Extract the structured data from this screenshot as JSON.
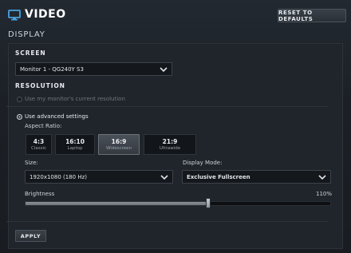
{
  "header": {
    "title": "VIDEO",
    "reset_label": "RESET TO DEFAULTS"
  },
  "subheader": "DISPLAY",
  "screen": {
    "section_label": "SCREEN",
    "monitor_value": "Monitor 1 - QG240Y S3"
  },
  "resolution": {
    "section_label": "RESOLUTION",
    "option_current": "Use my monitor's current resolution",
    "option_advanced": "Use advanced settings",
    "selected": "advanced",
    "aspect_label": "Aspect Ratio:",
    "aspect_options": [
      {
        "ratio": "4:3",
        "name": "Classic"
      },
      {
        "ratio": "16:10",
        "name": "Laptop"
      },
      {
        "ratio": "16:9",
        "name": "Widescreen"
      },
      {
        "ratio": "21:9",
        "name": "Ultrawide"
      }
    ],
    "aspect_selected": "16:9",
    "size_label": "Size:",
    "size_value": "1920x1080 (180 Hz)",
    "display_mode_label": "Display Mode:",
    "display_mode_value": "Exclusive Fullscreen"
  },
  "brightness": {
    "label": "Brightness",
    "value_text": "110%",
    "level_fraction": 0.6
  },
  "apply_label": "APPLY",
  "colors": {
    "background": "#1e2329",
    "accent_icon": "#4aa3e0",
    "active_aspect": "#4a5058"
  },
  "icons": {
    "title_icon": "monitor-icon",
    "dropdown_icon": "chevron-down-icon"
  }
}
